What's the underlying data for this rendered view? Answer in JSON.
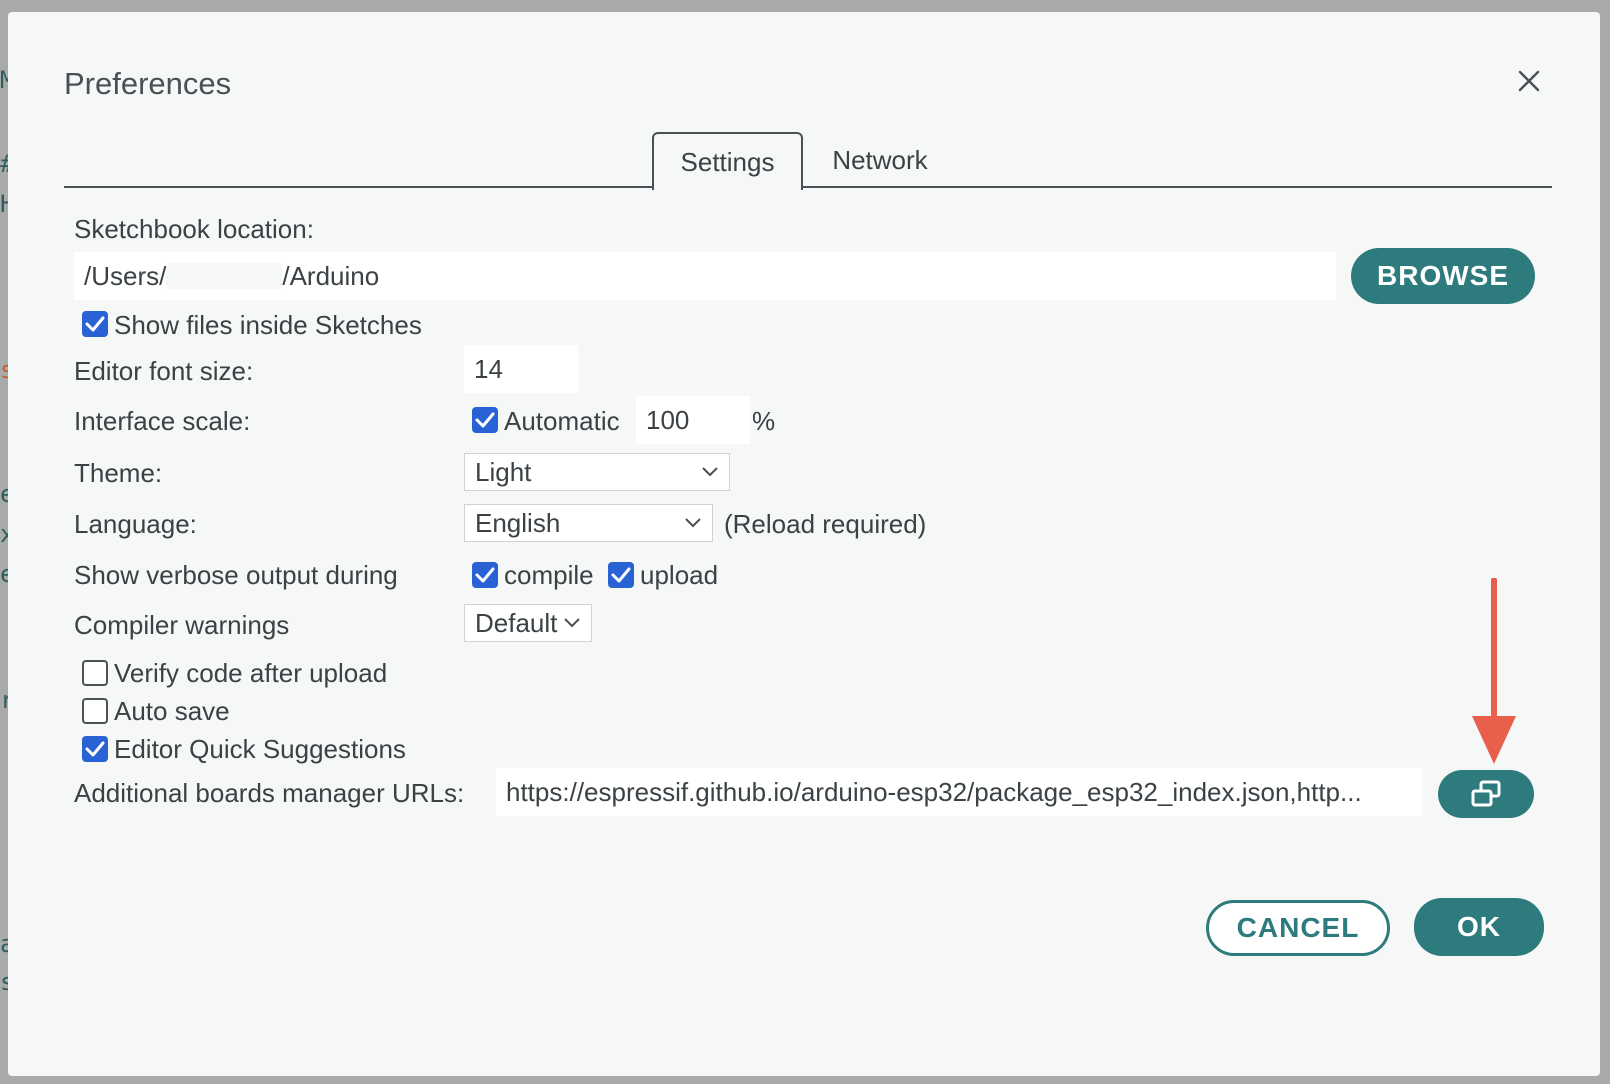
{
  "dialog": {
    "title": "Preferences",
    "close_icon": "close-icon"
  },
  "tabs": [
    {
      "label": "Settings",
      "active": true
    },
    {
      "label": "Network",
      "active": false
    }
  ],
  "sketchbook": {
    "label": "Sketchbook location:",
    "path_prefix": "/Users/",
    "path_suffix": "/Arduino",
    "browse_label": "BROWSE"
  },
  "show_files": {
    "label": "Show files inside Sketches",
    "checked": true
  },
  "font_size": {
    "label": "Editor font size:",
    "value": "14"
  },
  "interface_scale": {
    "label": "Interface scale:",
    "automatic_label": "Automatic",
    "automatic_checked": true,
    "value": "100",
    "unit": "%"
  },
  "theme": {
    "label": "Theme:",
    "value": "Light"
  },
  "language": {
    "label": "Language:",
    "value": "English",
    "note": "(Reload required)"
  },
  "verbose": {
    "label": "Show verbose output during",
    "compile_label": "compile",
    "compile_checked": true,
    "upload_label": "upload",
    "upload_checked": true
  },
  "compiler_warnings": {
    "label": "Compiler warnings",
    "value": "Default"
  },
  "verify_code": {
    "label": "Verify code after upload",
    "checked": false
  },
  "auto_save": {
    "label": "Auto save",
    "checked": false
  },
  "quick_suggestions": {
    "label": "Editor Quick Suggestions",
    "checked": true
  },
  "boards_urls": {
    "label": "Additional boards manager URLs:",
    "value": "https://espressif.github.io/arduino-esp32/package_esp32_index.json,http...",
    "edit_icon": "open-window-icon"
  },
  "footer": {
    "cancel_label": "CANCEL",
    "ok_label": "OK"
  },
  "colors": {
    "accent": "#2d7b7c",
    "checkbox": "#2962d4",
    "annotation_arrow": "#e8604c"
  }
}
